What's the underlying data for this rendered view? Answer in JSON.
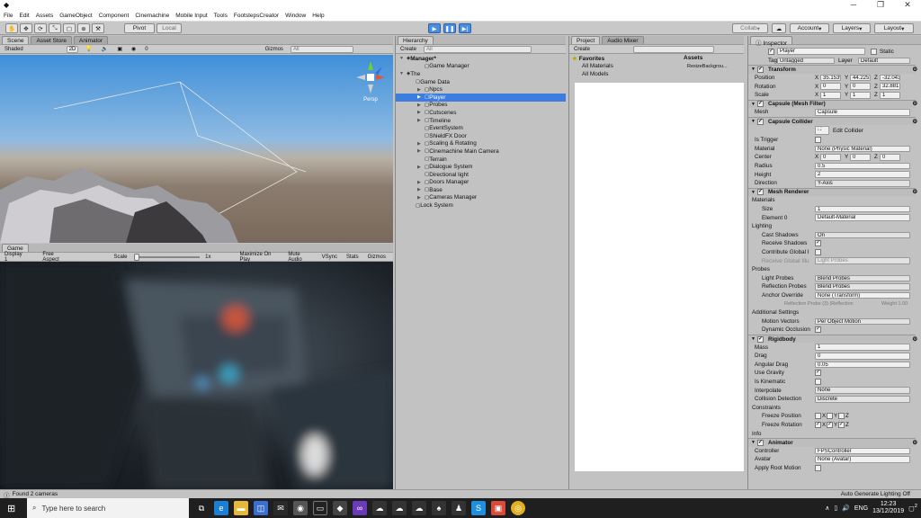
{
  "window": {
    "title": "",
    "controls": [
      "─",
      "❐",
      "✕"
    ]
  },
  "menu": [
    "File",
    "Edit",
    "Assets",
    "GameObject",
    "Component",
    "Cinemachine",
    "Mobile Input",
    "Tools",
    "FootstepsCreator",
    "Window",
    "Help"
  ],
  "toolbar": {
    "pivot": "Pivot",
    "local": "Local",
    "collab": "Collab",
    "account": "Account",
    "layers": "Layers",
    "layout": "Layout"
  },
  "scene": {
    "tabs": [
      "Scene",
      "Asset Store",
      "Animator"
    ],
    "shaded": "Shaded",
    "mode2d": "2D",
    "count": "0",
    "gizmos": "Gizmos",
    "search_placeholder": "All",
    "persp": "Persp"
  },
  "game": {
    "tab": "Game",
    "display": "Display 1",
    "aspect": "Free Aspect",
    "scale_label": "Scale",
    "scale_value": "1x",
    "buttons": [
      "Maximize On Play",
      "Mute Audio",
      "VSync",
      "Stats",
      "Gizmos"
    ]
  },
  "hierarchy": {
    "tab": "Hierarchy",
    "create": "Create",
    "search": "All",
    "items": [
      {
        "label": "Manager*",
        "indent": 0,
        "arrow": "▼",
        "bold": true
      },
      {
        "label": "Game Manager",
        "indent": 2,
        "arrow": ""
      },
      {
        "label": "The",
        "indent": 0,
        "arrow": "▼"
      },
      {
        "label": "Game Data",
        "indent": 1,
        "arrow": ""
      },
      {
        "label": "Npcs",
        "indent": 2,
        "arrow": "▶"
      },
      {
        "label": "Player",
        "indent": 2,
        "arrow": "▶",
        "selected": true
      },
      {
        "label": "Probes",
        "indent": 2,
        "arrow": "▶"
      },
      {
        "label": "Cutscenes",
        "indent": 2,
        "arrow": "▶"
      },
      {
        "label": "Timeline",
        "indent": 2,
        "arrow": "▶"
      },
      {
        "label": "EventSystem",
        "indent": 2,
        "arrow": ""
      },
      {
        "label": "ShieldFX Door",
        "indent": 2,
        "arrow": ""
      },
      {
        "label": "Scaling & Rotating",
        "indent": 2,
        "arrow": "▶"
      },
      {
        "label": "Cinemachine Main Camera",
        "indent": 2,
        "arrow": "▶"
      },
      {
        "label": "Terrain",
        "indent": 2,
        "arrow": ""
      },
      {
        "label": "Dialogue System",
        "indent": 2,
        "arrow": "▶"
      },
      {
        "label": "Directional light",
        "indent": 2,
        "arrow": ""
      },
      {
        "label": "Doors Manager",
        "indent": 2,
        "arrow": "▶"
      },
      {
        "label": "Base",
        "indent": 2,
        "arrow": "▶"
      },
      {
        "label": "Cameras Manager",
        "indent": 2,
        "arrow": "▶"
      },
      {
        "label": "Lock System",
        "indent": 1,
        "arrow": ""
      }
    ]
  },
  "project": {
    "tabs": [
      "Project",
      "Audio Mixer"
    ],
    "create": "Create",
    "favorites": "Favorites",
    "fav_items": [
      "All Materials",
      "All Models"
    ],
    "assets": "Assets",
    "asset_item": "ResizeBackgrou..."
  },
  "inspector": {
    "tab": "Inspector",
    "object_name": "Player",
    "static": "Static",
    "tag_label": "Tag",
    "tag": "Untagged",
    "layer_label": "Layer",
    "layer": "Default",
    "transform": {
      "title": "Transform",
      "position": [
        "35.1539",
        "44.2253",
        "-32.043"
      ],
      "rotation": [
        "0",
        "0",
        "32.881"
      ],
      "scale": [
        "1",
        "1",
        "1"
      ],
      "labels": [
        "Position",
        "Rotation",
        "Scale"
      ]
    },
    "mesh_filter": {
      "title": "Capsule (Mesh Filter)",
      "mesh_label": "Mesh",
      "mesh": "Capsule"
    },
    "capsule_collider": {
      "title": "Capsule Collider",
      "edit": "Edit Collider",
      "is_trigger": "Is Trigger",
      "material_label": "Material",
      "material": "None (Physic Material)",
      "center_label": "Center",
      "center": [
        "0",
        "0",
        "0"
      ],
      "radius_label": "Radius",
      "radius": "0.5",
      "height_label": "Height",
      "height": "2",
      "direction_label": "Direction",
      "direction": "Y-Axis"
    },
    "mesh_renderer": {
      "title": "Mesh Renderer",
      "materials": "Materials",
      "size_label": "Size",
      "size": "1",
      "element_label": "Element 0",
      "element": "Default-Material",
      "lighting": "Lighting",
      "cast_label": "Cast Shadows",
      "cast": "On",
      "receive_label": "Receive Shadows",
      "contribute_label": "Contribute Global I",
      "receive_gi_label": "Receive Global Illu",
      "receive_gi": "Light Probes",
      "probes": "Probes",
      "light_probes_label": "Light Probes",
      "light_probes": "Blend Probes",
      "refl_label": "Reflection Probes",
      "refl": "Blend Probes",
      "anchor_label": "Anchor Override",
      "anchor": "None (Transform)",
      "probe_line": "Reflection Probe (3) (Reflection",
      "weight": "Weight 1.00",
      "additional": "Additional Settings",
      "motion_label": "Motion Vectors",
      "motion": "Per Object Motion",
      "occlusion_label": "Dynamic Occlusion"
    },
    "rigidbody": {
      "title": "Rigidbody",
      "mass_label": "Mass",
      "mass": "1",
      "drag_label": "Drag",
      "drag": "0",
      "adrag_label": "Angular Drag",
      "adrag": "0.05",
      "gravity_label": "Use Gravity",
      "kinematic_label": "Is Kinematic",
      "interp_label": "Interpolate",
      "interp": "None",
      "coll_label": "Collision Detection",
      "coll": "Discrete",
      "constraints": "Constraints",
      "freeze_pos": "Freeze Position",
      "freeze_rot": "Freeze Rotation",
      "axes": [
        "X",
        "Y",
        "Z"
      ],
      "info": "Info"
    },
    "animator": {
      "title": "Animator",
      "controller_label": "Controller",
      "controller": "FPSController",
      "avatar_label": "Avatar",
      "avatar": "None (Avatar)",
      "root_label": "Apply Root Motion"
    }
  },
  "status": {
    "message": "Found 2 cameras",
    "right": "Auto Generate Lighting Off"
  },
  "taskbar": {
    "search": "Type here to search",
    "lang": "ENG",
    "time": "12:23",
    "date": "13/12/2019",
    "notif": "2"
  }
}
